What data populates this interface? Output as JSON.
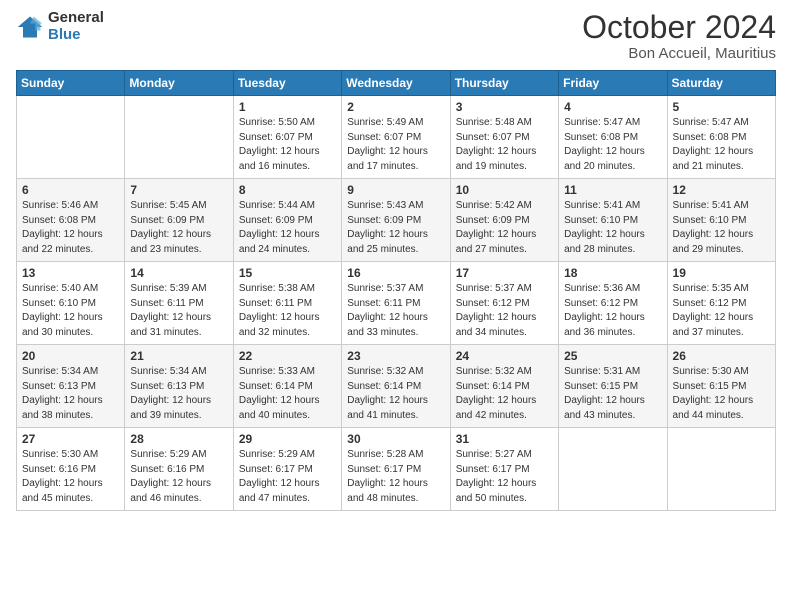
{
  "logo": {
    "general": "General",
    "blue": "Blue"
  },
  "header": {
    "month": "October 2024",
    "location": "Bon Accueil, Mauritius"
  },
  "weekdays": [
    "Sunday",
    "Monday",
    "Tuesday",
    "Wednesday",
    "Thursday",
    "Friday",
    "Saturday"
  ],
  "weeks": [
    [
      {
        "day": "",
        "empty": true
      },
      {
        "day": "",
        "empty": true
      },
      {
        "day": "1",
        "sunrise": "Sunrise: 5:50 AM",
        "sunset": "Sunset: 6:07 PM",
        "daylight": "Daylight: 12 hours and 16 minutes."
      },
      {
        "day": "2",
        "sunrise": "Sunrise: 5:49 AM",
        "sunset": "Sunset: 6:07 PM",
        "daylight": "Daylight: 12 hours and 17 minutes."
      },
      {
        "day": "3",
        "sunrise": "Sunrise: 5:48 AM",
        "sunset": "Sunset: 6:07 PM",
        "daylight": "Daylight: 12 hours and 19 minutes."
      },
      {
        "day": "4",
        "sunrise": "Sunrise: 5:47 AM",
        "sunset": "Sunset: 6:08 PM",
        "daylight": "Daylight: 12 hours and 20 minutes."
      },
      {
        "day": "5",
        "sunrise": "Sunrise: 5:47 AM",
        "sunset": "Sunset: 6:08 PM",
        "daylight": "Daylight: 12 hours and 21 minutes."
      }
    ],
    [
      {
        "day": "6",
        "sunrise": "Sunrise: 5:46 AM",
        "sunset": "Sunset: 6:08 PM",
        "daylight": "Daylight: 12 hours and 22 minutes."
      },
      {
        "day": "7",
        "sunrise": "Sunrise: 5:45 AM",
        "sunset": "Sunset: 6:09 PM",
        "daylight": "Daylight: 12 hours and 23 minutes."
      },
      {
        "day": "8",
        "sunrise": "Sunrise: 5:44 AM",
        "sunset": "Sunset: 6:09 PM",
        "daylight": "Daylight: 12 hours and 24 minutes."
      },
      {
        "day": "9",
        "sunrise": "Sunrise: 5:43 AM",
        "sunset": "Sunset: 6:09 PM",
        "daylight": "Daylight: 12 hours and 25 minutes."
      },
      {
        "day": "10",
        "sunrise": "Sunrise: 5:42 AM",
        "sunset": "Sunset: 6:09 PM",
        "daylight": "Daylight: 12 hours and 27 minutes."
      },
      {
        "day": "11",
        "sunrise": "Sunrise: 5:41 AM",
        "sunset": "Sunset: 6:10 PM",
        "daylight": "Daylight: 12 hours and 28 minutes."
      },
      {
        "day": "12",
        "sunrise": "Sunrise: 5:41 AM",
        "sunset": "Sunset: 6:10 PM",
        "daylight": "Daylight: 12 hours and 29 minutes."
      }
    ],
    [
      {
        "day": "13",
        "sunrise": "Sunrise: 5:40 AM",
        "sunset": "Sunset: 6:10 PM",
        "daylight": "Daylight: 12 hours and 30 minutes."
      },
      {
        "day": "14",
        "sunrise": "Sunrise: 5:39 AM",
        "sunset": "Sunset: 6:11 PM",
        "daylight": "Daylight: 12 hours and 31 minutes."
      },
      {
        "day": "15",
        "sunrise": "Sunrise: 5:38 AM",
        "sunset": "Sunset: 6:11 PM",
        "daylight": "Daylight: 12 hours and 32 minutes."
      },
      {
        "day": "16",
        "sunrise": "Sunrise: 5:37 AM",
        "sunset": "Sunset: 6:11 PM",
        "daylight": "Daylight: 12 hours and 33 minutes."
      },
      {
        "day": "17",
        "sunrise": "Sunrise: 5:37 AM",
        "sunset": "Sunset: 6:12 PM",
        "daylight": "Daylight: 12 hours and 34 minutes."
      },
      {
        "day": "18",
        "sunrise": "Sunrise: 5:36 AM",
        "sunset": "Sunset: 6:12 PM",
        "daylight": "Daylight: 12 hours and 36 minutes."
      },
      {
        "day": "19",
        "sunrise": "Sunrise: 5:35 AM",
        "sunset": "Sunset: 6:12 PM",
        "daylight": "Daylight: 12 hours and 37 minutes."
      }
    ],
    [
      {
        "day": "20",
        "sunrise": "Sunrise: 5:34 AM",
        "sunset": "Sunset: 6:13 PM",
        "daylight": "Daylight: 12 hours and 38 minutes."
      },
      {
        "day": "21",
        "sunrise": "Sunrise: 5:34 AM",
        "sunset": "Sunset: 6:13 PM",
        "daylight": "Daylight: 12 hours and 39 minutes."
      },
      {
        "day": "22",
        "sunrise": "Sunrise: 5:33 AM",
        "sunset": "Sunset: 6:14 PM",
        "daylight": "Daylight: 12 hours and 40 minutes."
      },
      {
        "day": "23",
        "sunrise": "Sunrise: 5:32 AM",
        "sunset": "Sunset: 6:14 PM",
        "daylight": "Daylight: 12 hours and 41 minutes."
      },
      {
        "day": "24",
        "sunrise": "Sunrise: 5:32 AM",
        "sunset": "Sunset: 6:14 PM",
        "daylight": "Daylight: 12 hours and 42 minutes."
      },
      {
        "day": "25",
        "sunrise": "Sunrise: 5:31 AM",
        "sunset": "Sunset: 6:15 PM",
        "daylight": "Daylight: 12 hours and 43 minutes."
      },
      {
        "day": "26",
        "sunrise": "Sunrise: 5:30 AM",
        "sunset": "Sunset: 6:15 PM",
        "daylight": "Daylight: 12 hours and 44 minutes."
      }
    ],
    [
      {
        "day": "27",
        "sunrise": "Sunrise: 5:30 AM",
        "sunset": "Sunset: 6:16 PM",
        "daylight": "Daylight: 12 hours and 45 minutes."
      },
      {
        "day": "28",
        "sunrise": "Sunrise: 5:29 AM",
        "sunset": "Sunset: 6:16 PM",
        "daylight": "Daylight: 12 hours and 46 minutes."
      },
      {
        "day": "29",
        "sunrise": "Sunrise: 5:29 AM",
        "sunset": "Sunset: 6:17 PM",
        "daylight": "Daylight: 12 hours and 47 minutes."
      },
      {
        "day": "30",
        "sunrise": "Sunrise: 5:28 AM",
        "sunset": "Sunset: 6:17 PM",
        "daylight": "Daylight: 12 hours and 48 minutes."
      },
      {
        "day": "31",
        "sunrise": "Sunrise: 5:27 AM",
        "sunset": "Sunset: 6:17 PM",
        "daylight": "Daylight: 12 hours and 50 minutes."
      },
      {
        "day": "",
        "empty": true
      },
      {
        "day": "",
        "empty": true
      }
    ]
  ]
}
